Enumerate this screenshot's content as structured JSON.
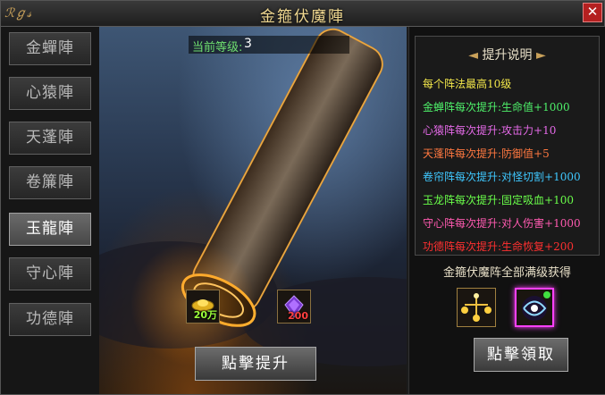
{
  "window": {
    "title": "金箍伏魔陣",
    "logo": "ℛℊ𝓈",
    "close_glyph": "✕"
  },
  "sidebar": {
    "active_index": 4,
    "items": [
      {
        "label": "金蟬陣"
      },
      {
        "label": "心猿陣"
      },
      {
        "label": "天蓬陣"
      },
      {
        "label": "卷簾陣"
      },
      {
        "label": "玉龍陣"
      },
      {
        "label": "守心陣"
      },
      {
        "label": "功德陣"
      }
    ]
  },
  "main": {
    "level_label": "当前等级:",
    "level_value": "3",
    "costs": [
      {
        "icon": "gold-ingot-icon",
        "count": "20万",
        "color": "#9cff3a"
      },
      {
        "icon": "purple-crystal-icon",
        "count": "200",
        "color": "#ff4040"
      }
    ],
    "upgrade_button": "點擊提升"
  },
  "info": {
    "title": "提升说明",
    "rules": [
      {
        "text": "每个阵法最高10级",
        "color": "#f2e64a"
      },
      {
        "text": "金蝉阵每次提升:生命值+1000",
        "color": "#4ef06a"
      },
      {
        "text": "心猿阵每次提升:攻击力+10",
        "color": "#e56ae8"
      },
      {
        "text": "天蓬阵每次提升:防御值+5",
        "color": "#ff7840"
      },
      {
        "text": "卷帘阵每次提升:对怪切割+1000",
        "color": "#3fc8ff"
      },
      {
        "text": "玉龙阵每次提升:固定吸血+100",
        "color": "#6aff4a"
      },
      {
        "text": "守心阵每次提升:对人伤害+1000",
        "color": "#ff5ab0"
      },
      {
        "text": "功德阵每次提升:生命恢复+200",
        "color": "#ff3030"
      }
    ]
  },
  "reward": {
    "heading": "金箍伏魔阵全部满级获得",
    "items": [
      {
        "icon": "golden-lamps-icon"
      },
      {
        "icon": "swirl-orb-icon"
      }
    ],
    "claim_button": "點擊領取"
  }
}
